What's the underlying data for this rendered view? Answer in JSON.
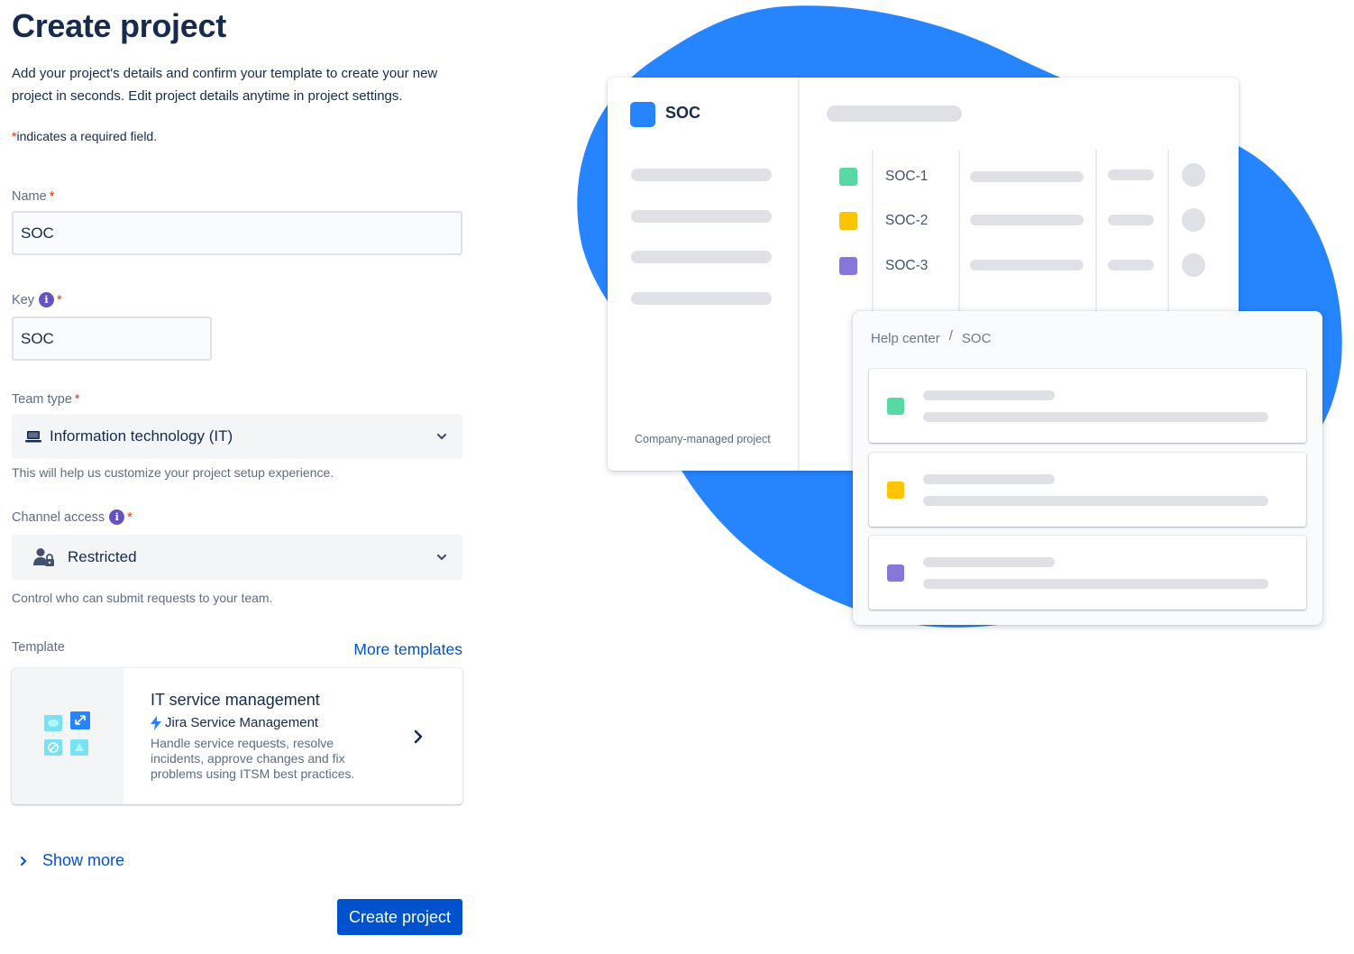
{
  "page": {
    "title": "Create project",
    "description": "Add your project's details and confirm your template to create your new project in seconds. Edit project details anytime in project settings.",
    "required_note_star": "*",
    "required_note": "indicates a required field."
  },
  "fields": {
    "name": {
      "label": "Name",
      "value": "SOC"
    },
    "key": {
      "label": "Key",
      "value": "SOC"
    },
    "team_type": {
      "label": "Team type",
      "value": "Information technology (IT)",
      "icon": "laptop-icon",
      "helper": "This will help us customize your project setup experience."
    },
    "channel_access": {
      "label": "Channel access",
      "value": "Restricted",
      "icon": "user-lock-icon",
      "helper": "Control who can submit requests to your team."
    }
  },
  "template": {
    "label": "Template",
    "more_link": "More templates",
    "card": {
      "title": "IT service management",
      "product": "Jira Service Management",
      "description": "Handle service requests, resolve incidents, approve changes and fix problems using ITSM best practices."
    }
  },
  "show_more": "Show more",
  "submit": "Create project",
  "preview": {
    "project_name": "SOC",
    "project_type": "Company-managed project",
    "issues": [
      {
        "key": "SOC-1",
        "color": "#57d9a3"
      },
      {
        "key": "SOC-2",
        "color": "#ffc400"
      },
      {
        "key": "SOC-3",
        "color": "#8777d9"
      }
    ],
    "breadcrumb": [
      "Help center",
      "/",
      "SOC"
    ],
    "request_type_colors": [
      "#57d9a3",
      "#ffc400",
      "#8777d9"
    ]
  },
  "colors": {
    "primary": "#0052cc",
    "blob": "#2684ff",
    "required": "#de350b",
    "info": "#6554c0"
  }
}
